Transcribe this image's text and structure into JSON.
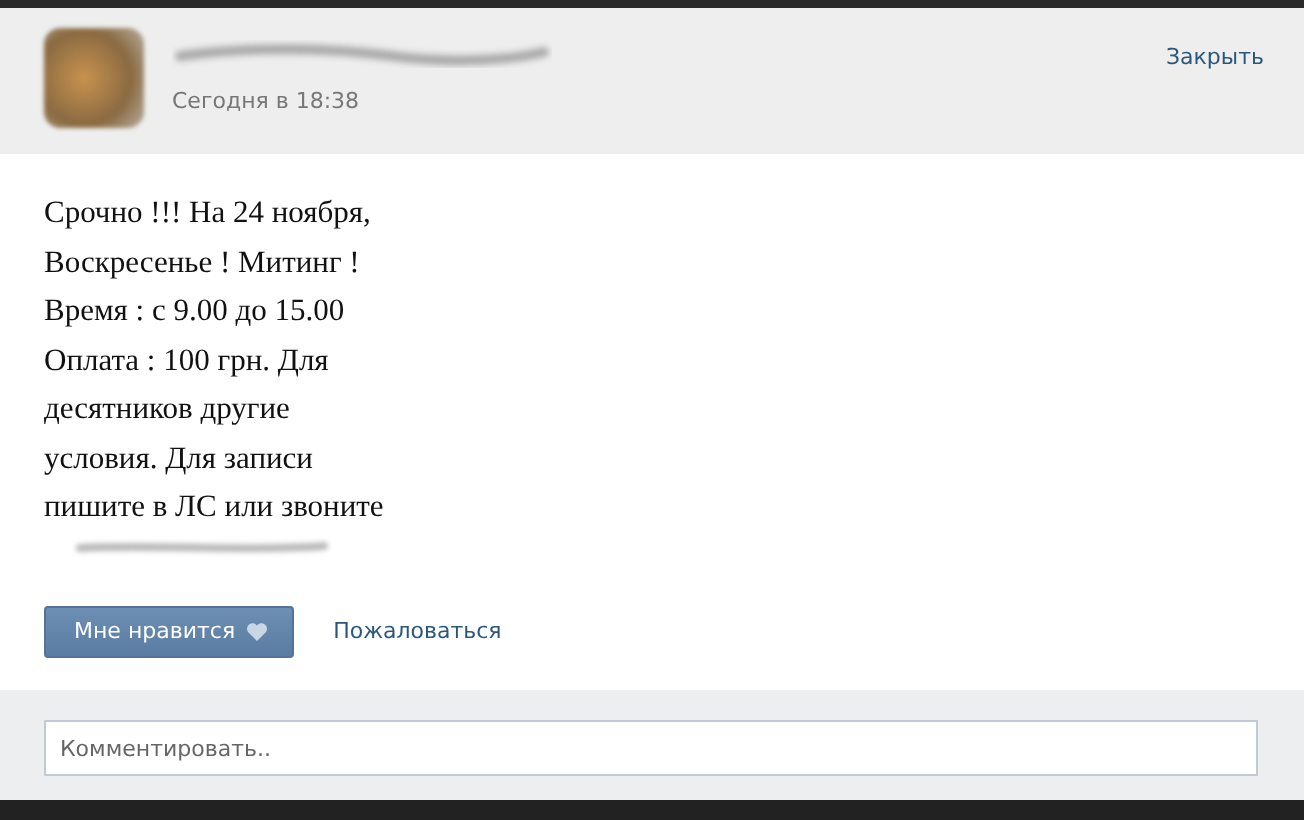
{
  "post": {
    "time": "Сегодня в 18:38",
    "close": "Закрыть",
    "text": "Срочно !!! На 24 ноября,\nВоскресенье ! Митинг !\nВремя : с 9.00 до 15.00\nОплата : 100 грн. Для\nдесятников другие\nусловия. Для записи\nпишите в ЛС или звоните",
    "like_button": "Мне нравится",
    "report_link": "Пожаловаться"
  },
  "comment": {
    "placeholder": "Комментировать.."
  }
}
